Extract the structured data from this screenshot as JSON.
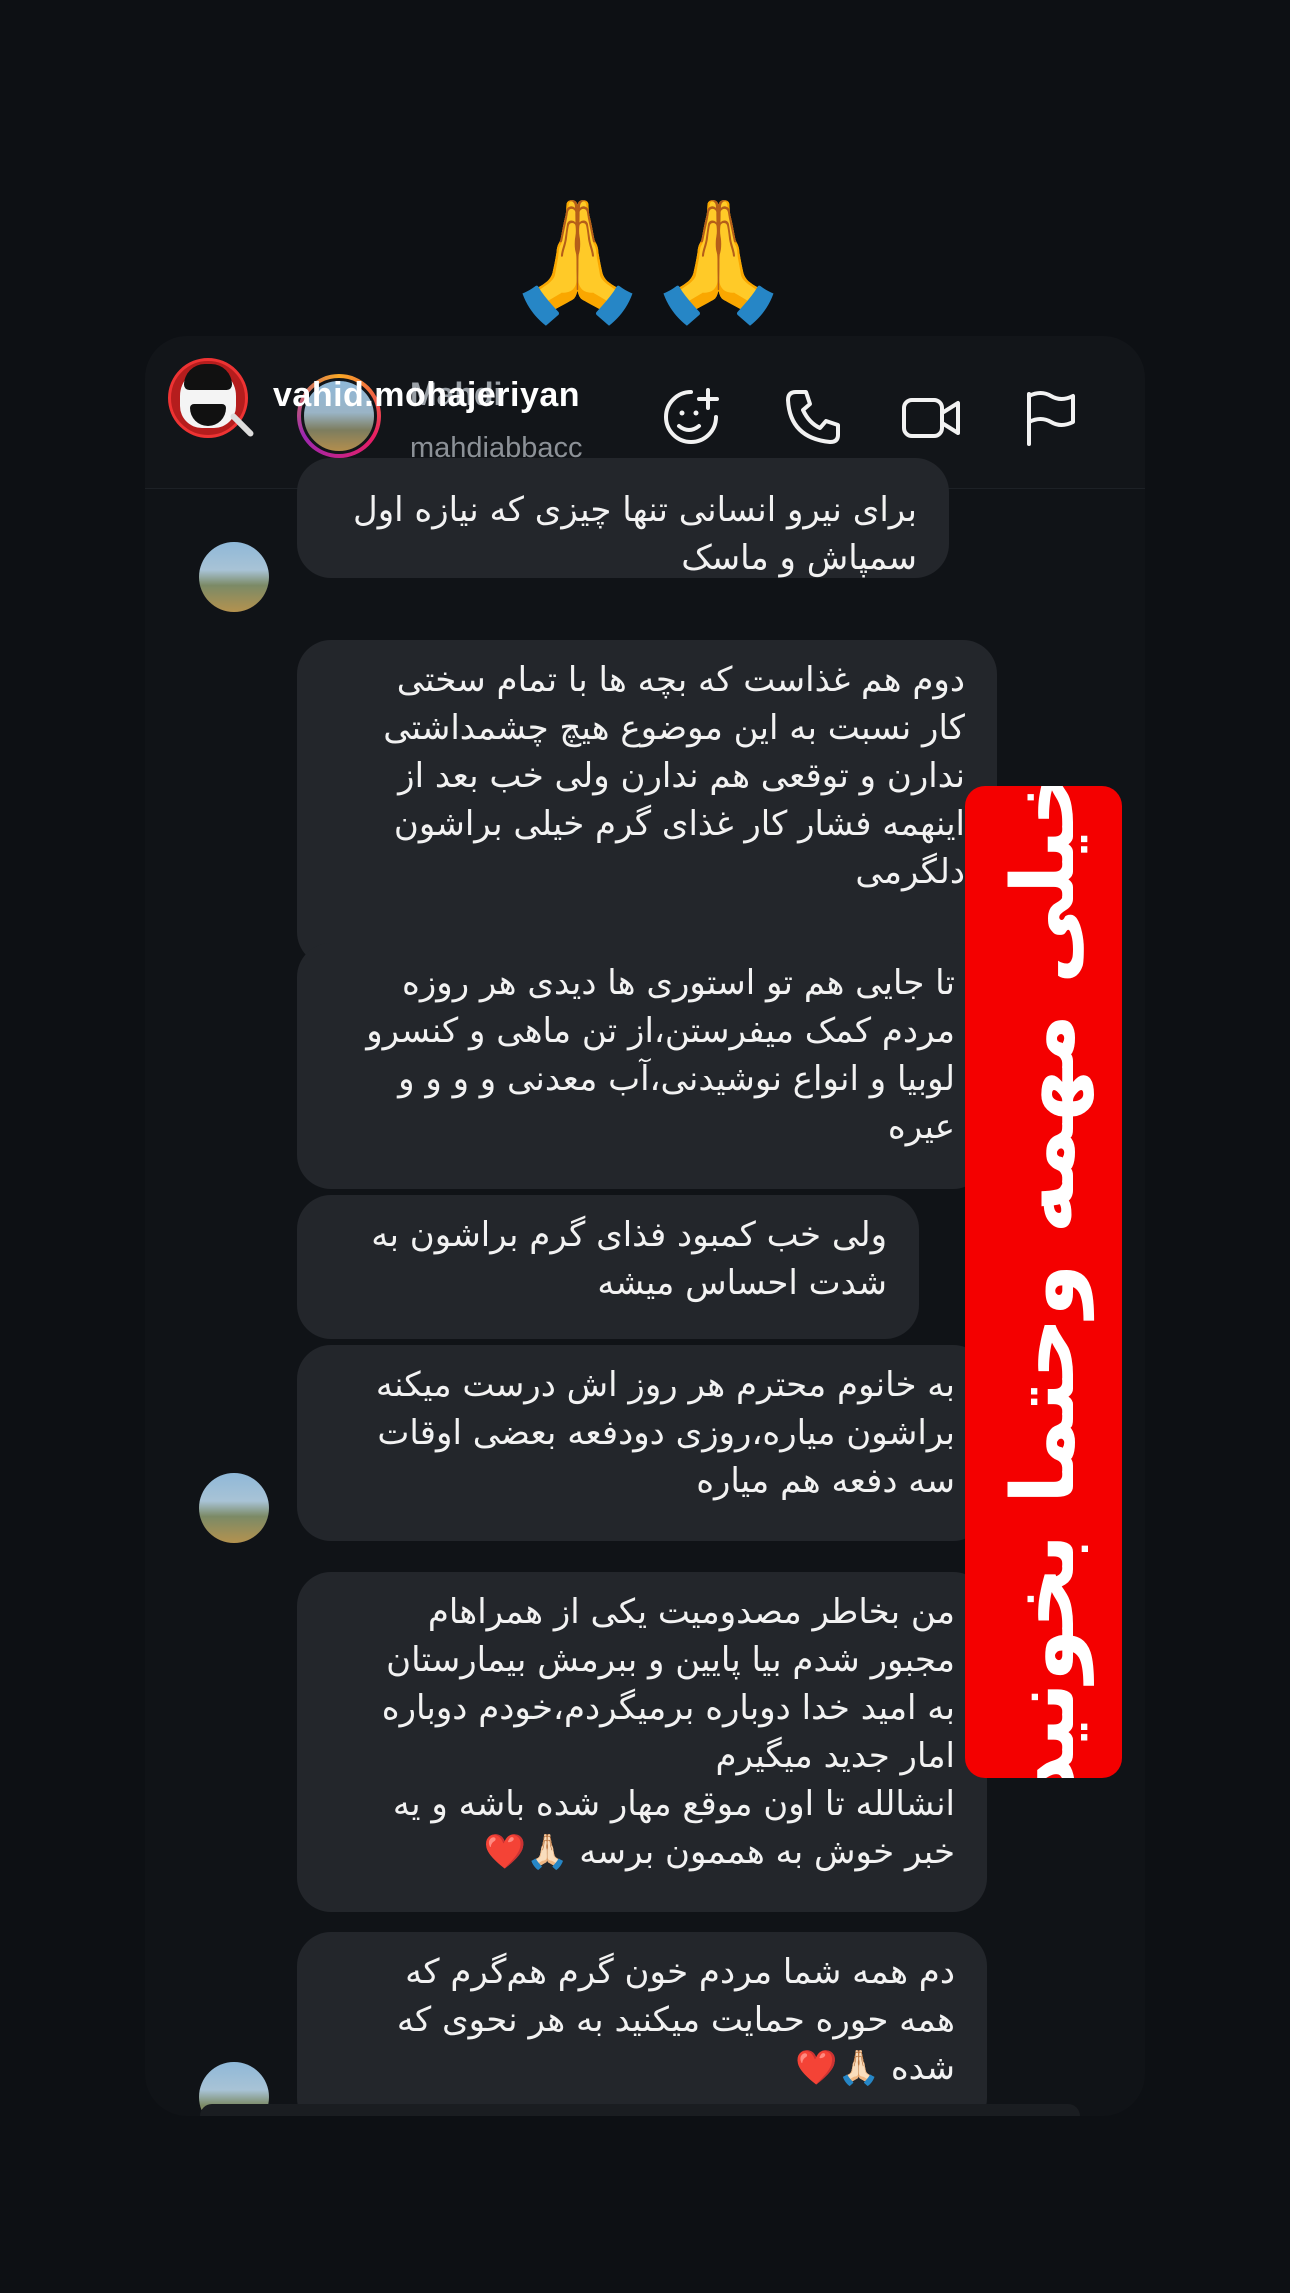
{
  "top_emoji": "🙏🙏",
  "header": {
    "contact_name": "Mahdi",
    "contact_handle": "mahdiabbacc",
    "overlay_username": "vahid.mohajeriyan",
    "icons": [
      "sticker-add-icon",
      "phone-icon",
      "video-icon",
      "flag-icon"
    ]
  },
  "messages": [
    {
      "text": "برای نیرو انسانی تنها چیزی که نیازه اول\nسمپاش و ماسک"
    },
    {
      "text": "دوم هم غذاست که بچه ها با تمام سختی\nکار نسبت به این موضوع هیچ چشمداشتی\nندارن و توقعی هم ندارن ولی خب بعد از\nاینهمه فشار کار غذای گرم خیلی براشون\nدلگرمی"
    },
    {
      "text": "تا جایی هم تو استوری ها دیدی هر روزه\nمردم کمک میفرستن،از تن ماهی و کنسرو\nلوبیا و انواع نوشیدنی،آب معدنی و و و و\nعیره"
    },
    {
      "text": "ولی خب کمبود  فذای گرم براشون به\nشدت احساس میشه"
    },
    {
      "text": "به خانوم محترم هر روز اش درست میکنه\nبراشون میاره،روزی دودفعه بعضی اوقات\nسه دفعه هم میاره"
    },
    {
      "text": "من بخاطر مصدومیت یکی از همراهام\nمجبور شدم بیا پایین و ببرمش بیمارستان\nبه امید خدا دوباره برمیگردم،خودم دوباره\nامار جدید میگیرم\nانشالله تا اون موقع مهار شده باشه و یه\nخبر خوش به هممون برسه 🙏🏻❤️"
    },
    {
      "text": "دم همه شما مردم خون گرم هم‌گرم که\nهمه حوره حمایت میکنید به هر نحوی که\nشده 🙏🏻❤️"
    }
  ],
  "banner": {
    "text": "خیلی مهمه وحتما بخونید",
    "color": "#f40000"
  }
}
